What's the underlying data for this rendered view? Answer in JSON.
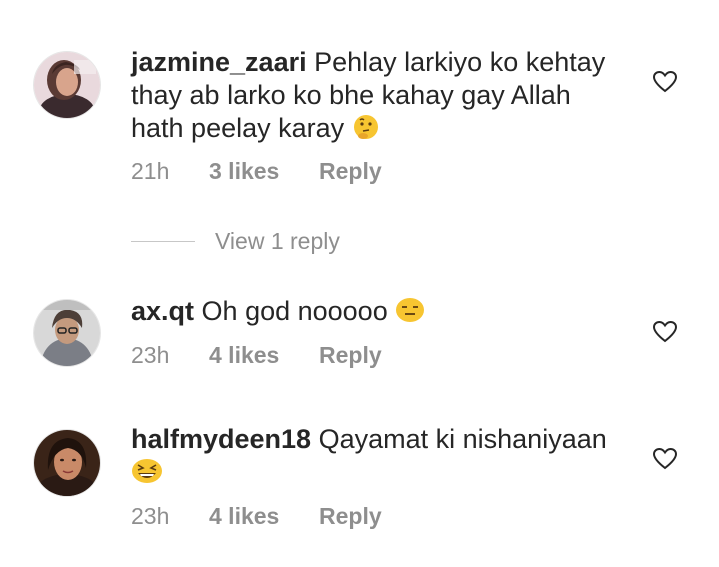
{
  "comments": [
    {
      "username": "jazmine_zaari",
      "text": "Pehlay larkiyo ko kehtay thay ab larko ko bhe kahay gay Allah hath peelay karay",
      "emoji": "thinking-face",
      "time": "21h",
      "likes": "3 likes",
      "reply": "Reply",
      "view_replies": "View 1 reply"
    },
    {
      "username": "ax.qt",
      "text": "Oh god nooooo",
      "emoji": "expressionless-face",
      "time": "23h",
      "likes": "4 likes",
      "reply": "Reply"
    },
    {
      "username": "halfmydeen18",
      "text": "Qayamat ki nishaniyaan",
      "emoji": "grinning-squinting-face",
      "time": "23h",
      "likes": "4 likes",
      "reply": "Reply"
    }
  ],
  "colors": {
    "text": "#262626",
    "meta": "#8e8e8e",
    "divider": "#c7c7c7",
    "emoji": "#f7c531"
  }
}
